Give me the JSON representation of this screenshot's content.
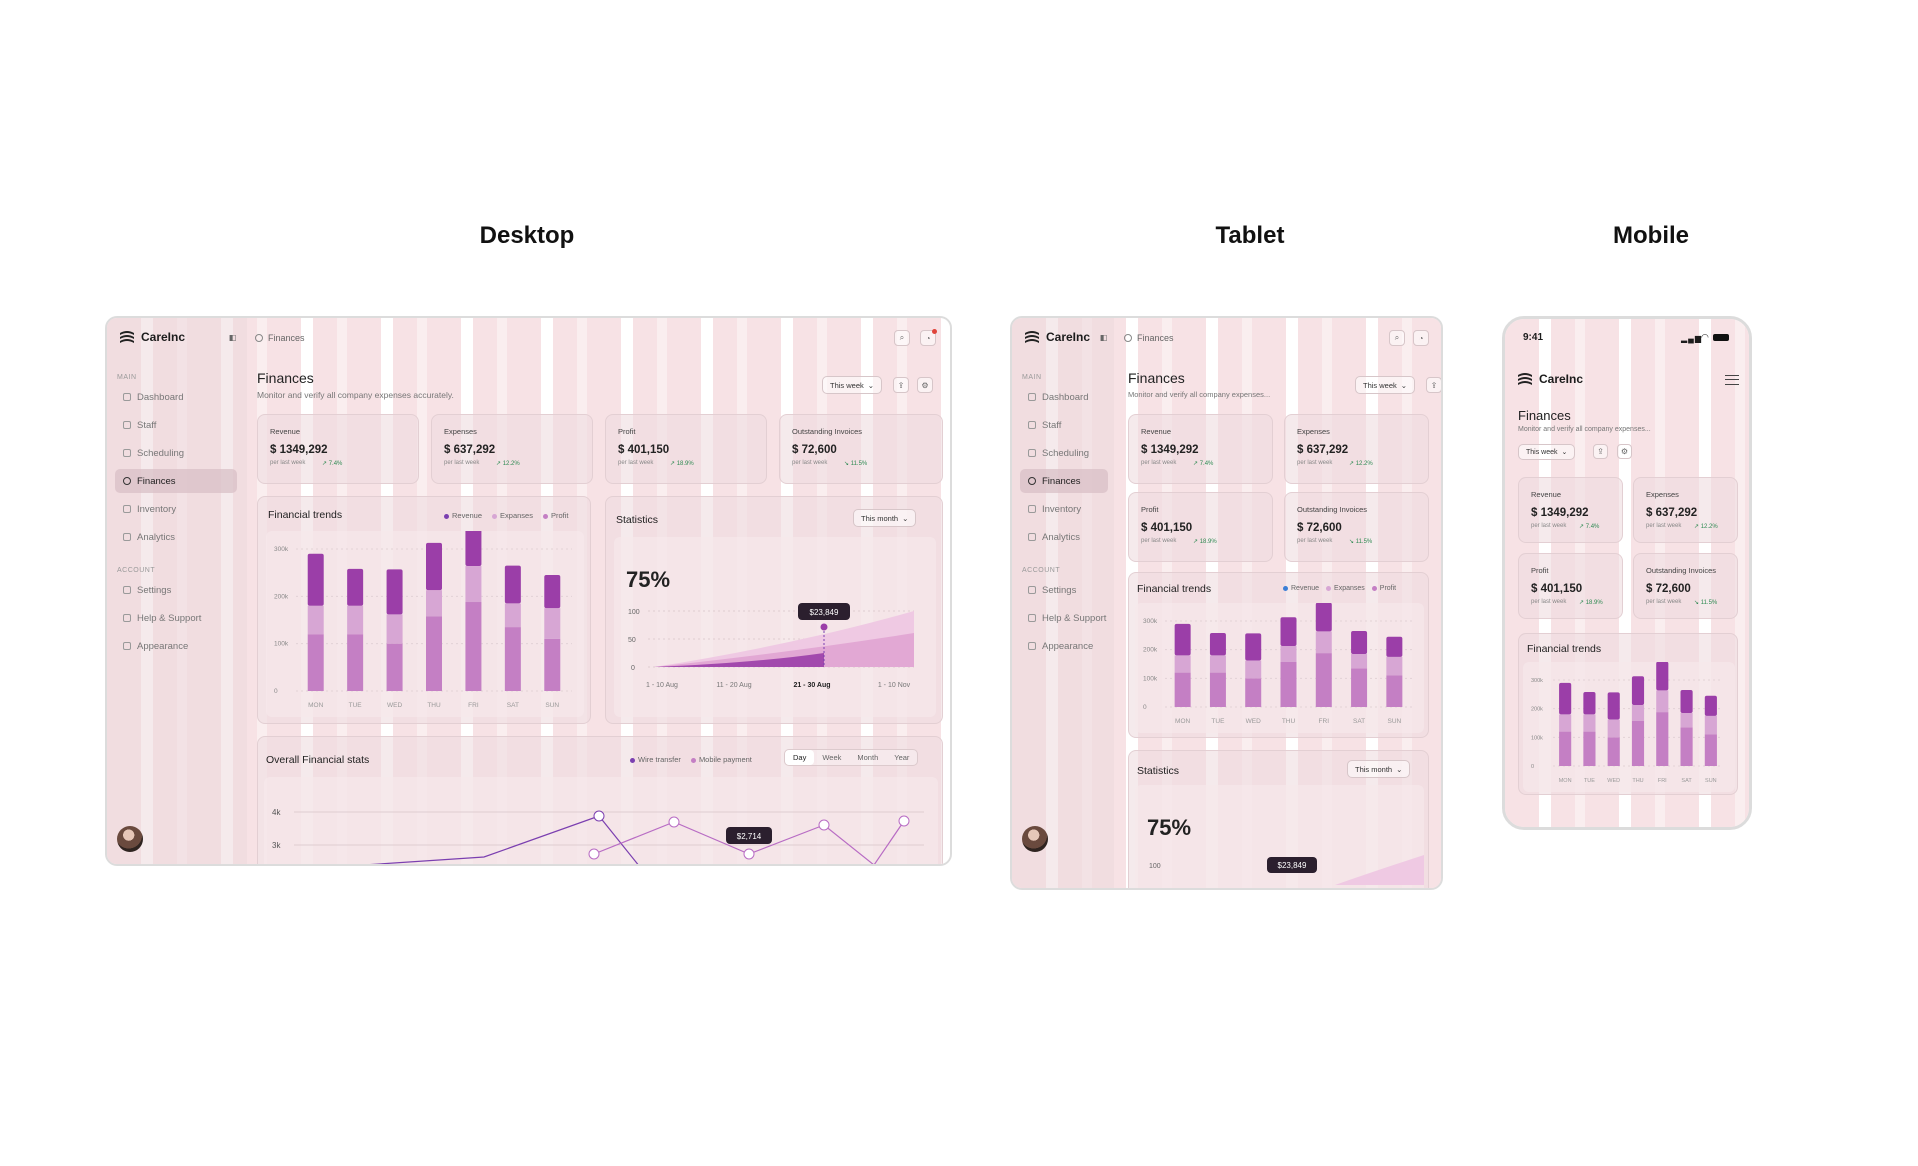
{
  "headings": {
    "desktop": "Desktop",
    "tablet": "Tablet",
    "mobile": "Mobile"
  },
  "brand": {
    "name": "CareInc"
  },
  "breadcrumb": "Finances",
  "sidebar": {
    "main_label": "MAIN",
    "account_label": "ACCOUNT",
    "items": [
      "Dashboard",
      "Staff",
      "Scheduling",
      "Finances",
      "Inventory",
      "Analytics"
    ],
    "account_items": [
      "Settings",
      "Help & Support",
      "Appearance"
    ],
    "active": "Finances"
  },
  "page": {
    "title": "Finances",
    "subtitle": "Monitor and verify all company expenses accurately.",
    "subtitle_short": "Monitor and verify all company expenses...",
    "period": "This week"
  },
  "kpis": [
    {
      "label": "Revenue",
      "value": "$ 1349,292",
      "per": "per last week",
      "change": "↗ 7.4%"
    },
    {
      "label": "Expenses",
      "value": "$ 637,292",
      "per": "per last week",
      "change": "↗ 12.2%"
    },
    {
      "label": "Profit",
      "value": "$ 401,150",
      "per": "per last week",
      "change": "↗ 18.9%"
    },
    {
      "label": "Outstanding Invoices",
      "value": "$ 72,600",
      "per": "per last week",
      "change": "↘ 11.5%"
    }
  ],
  "trends": {
    "title": "Financial trends",
    "legend": [
      "Revenue",
      "Expanses",
      "Profit"
    ]
  },
  "statistics": {
    "title": "Statistics",
    "period": "This month",
    "percent": "75%",
    "tooltip": "$23,849"
  },
  "overall": {
    "title": "Overall Financial stats",
    "legend": [
      "Wire transfer",
      "Mobile payment"
    ],
    "tabs": [
      "Day",
      "Week",
      "Month",
      "Year"
    ],
    "active_tab": "Day",
    "tooltip": "$2,714"
  },
  "mobile_status": {
    "time": "9:41"
  },
  "colors": {
    "revenue": "#9b3ea8",
    "expenses": "#d7a6d4",
    "profit": "#c47fc4",
    "accent": "#7b3fb0",
    "positive": "#2e8a52"
  },
  "chart_data": [
    {
      "type": "bar",
      "title": "Financial trends",
      "categories": [
        "MON",
        "TUE",
        "WED",
        "THU",
        "FRI",
        "SAT",
        "SUN"
      ],
      "ylim": [
        0,
        300
      ],
      "yticks": [
        "0",
        "100k",
        "200k",
        "300k"
      ],
      "series": [
        {
          "name": "Revenue",
          "values": [
            110,
            78,
            95,
            100,
            100,
            80,
            70
          ]
        },
        {
          "name": "Expanses",
          "values": [
            60,
            60,
            62,
            55,
            76,
            50,
            65
          ]
        },
        {
          "name": "Profit",
          "values": [
            120,
            120,
            100,
            158,
            188,
            135,
            110
          ]
        }
      ]
    },
    {
      "type": "area",
      "title": "Statistics",
      "categories": [
        "1 - 10 Aug",
        "11 - 20 Aug",
        "21 - 30 Aug",
        "1 - 10 Nov"
      ],
      "ylim": [
        0,
        100
      ],
      "yticks": [
        "0",
        "50",
        "100"
      ],
      "highlight": {
        "category": "21 - 30 Aug",
        "label": "$23,849"
      }
    },
    {
      "type": "line",
      "title": "Overall Financial stats",
      "yticks": [
        "3k",
        "4k"
      ],
      "series": [
        {
          "name": "Wire transfer"
        },
        {
          "name": "Mobile payment"
        }
      ],
      "highlight": {
        "label": "$2,714"
      }
    }
  ]
}
